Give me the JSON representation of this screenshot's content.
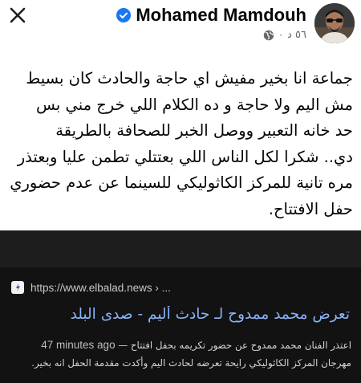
{
  "post": {
    "author_name": "Mohamed Mamdouh",
    "time": "٥٦ د",
    "dot": "·",
    "text_lines": [
      "جماعة انا بخير مفيش اي حاجة والحادث كان بسيط",
      "مش اليم ولا حاجة و ده الكلام اللي خرج مني بس",
      "حد خانه التعبير ووصل الخبر للصحافة بالطريقة",
      "دي.. شكرا لكل الناس اللي بعتتلي تطمن عليا وبعتذر",
      "مره تانية للمركز الكاثوليكي للسينما عن عدم حضوري",
      "حفل الافتتاح."
    ]
  },
  "link_preview": {
    "url": "https://www.elbalad.news › ...",
    "headline": "تعرض محمد ممدوح لـ حادث أليم - صدى البلد",
    "snippet_time": "47 minutes ago",
    "snippet_dash": "—",
    "snippet_line1": "اعتذر الفنان محمد ممدوح عن حضور تكريمه بحفل افتتاح",
    "snippet_line2": "مهرجان المركز الكاثوليكي رايحة تعرضه لحادث اليم وأكدت مقدمة الحفل انه بخير."
  },
  "colors": {
    "verified": "#1877f2",
    "link": "#8ab4f8",
    "text": "#050505",
    "muted": "#65676b"
  },
  "icons": {
    "close": "close-icon",
    "verified": "verified-badge-icon",
    "privacy": "globe-icon",
    "source": "site-favicon-icon"
  }
}
